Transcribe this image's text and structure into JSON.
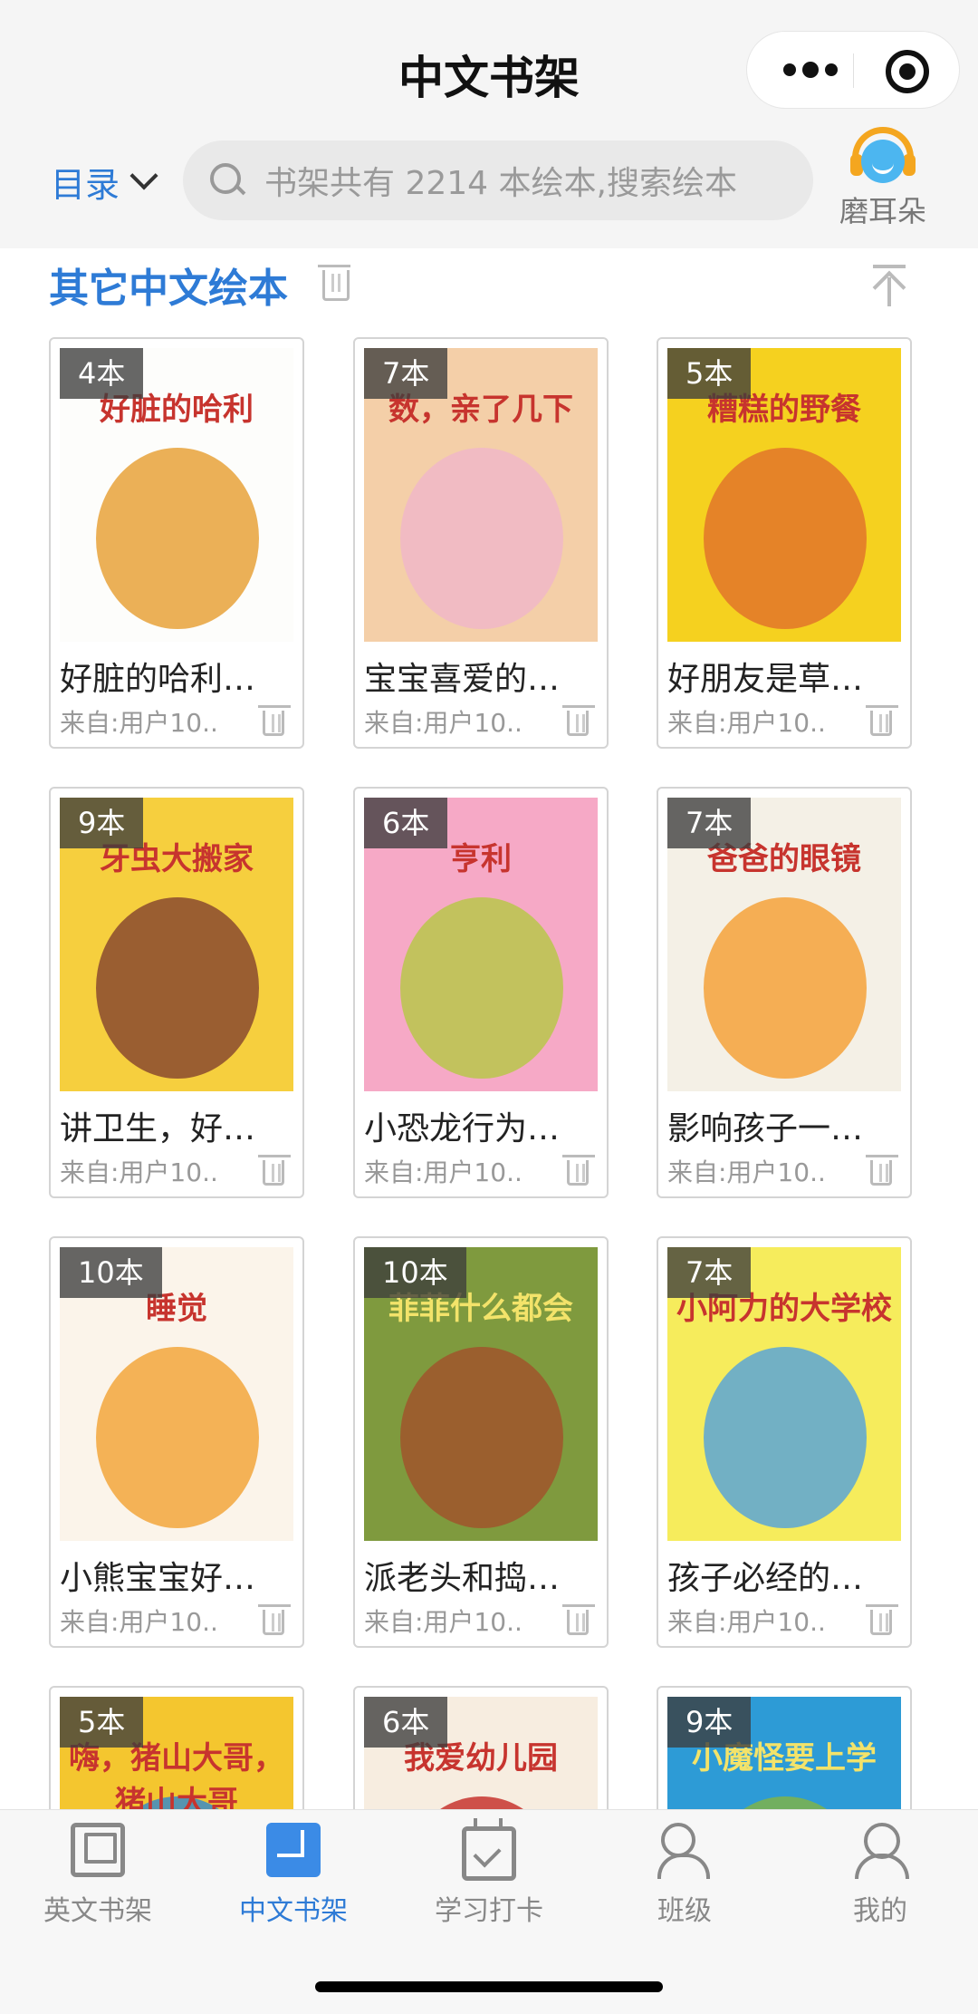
{
  "header": {
    "title": "中文书架",
    "menu_label": "目录",
    "search_placeholder": "书架共有 2214 本绘本,搜索绘本",
    "listen_label": "磨耳朵"
  },
  "section": {
    "title": "其它中文绘本"
  },
  "books": [
    {
      "count": "4本",
      "cover_text": "好脏的哈利",
      "title": "好脏的哈利…",
      "from": "来自:用户10..",
      "colors": [
        "#fdfdfb",
        "#e8a23a"
      ]
    },
    {
      "count": "7本",
      "cover_text": "数，亲了几下",
      "title": "宝宝喜爱的…",
      "from": "来自:用户10..",
      "colors": [
        "#f4cfa8",
        "#f0b7c8"
      ]
    },
    {
      "count": "5本",
      "cover_text": "糟糕的野餐",
      "title": "好朋友是草…",
      "from": "来自:用户10..",
      "colors": [
        "#f5d11f",
        "#e2762a"
      ]
    },
    {
      "count": "9本",
      "cover_text": "牙虫大搬家",
      "title": "讲卫生，好…",
      "from": "来自:用户10..",
      "colors": [
        "#f6cf3e",
        "#8a4a2f"
      ]
    },
    {
      "count": "6本",
      "cover_text": "亨利",
      "title": "小恐龙行为…",
      "from": "来自:用户10..",
      "colors": [
        "#f6a9c6",
        "#b8c74a"
      ]
    },
    {
      "count": "7本",
      "cover_text": "爸爸的眼镜",
      "title": "影响孩子一…",
      "from": "来自:用户10..",
      "colors": [
        "#f4f0e6",
        "#f5a23a"
      ]
    },
    {
      "count": "10本",
      "cover_text": "睡觉",
      "title": "小熊宝宝好…",
      "from": "来自:用户10..",
      "colors": [
        "#fbf4ea",
        "#f2a63c"
      ]
    },
    {
      "count": "10本",
      "cover_text": "菲菲什么都会",
      "title": "派老头和捣…",
      "from": "来自:用户10..",
      "colors": [
        "#7f9a3e",
        "#a0552c"
      ]
    },
    {
      "count": "7本",
      "cover_text": "小阿力的大学校",
      "title": "孩子必经的…",
      "from": "来自:用户10..",
      "colors": [
        "#f6ec5c",
        "#5aa6d6"
      ]
    },
    {
      "count": "5本",
      "cover_text": "嗨，猪山大哥，猪山大哥",
      "title": "",
      "from": "",
      "colors": [
        "#f4c62f",
        "#3a8bc7"
      ]
    },
    {
      "count": "6本",
      "cover_text": "我爱幼儿园",
      "title": "",
      "from": "",
      "colors": [
        "#f7ede0",
        "#c7342e"
      ]
    },
    {
      "count": "9本",
      "cover_text": "小魔怪要上学",
      "title": "",
      "from": "",
      "colors": [
        "#2d9bd6",
        "#7fb34a"
      ]
    }
  ],
  "tabs": [
    {
      "label": "英文书架",
      "icon": "book-icon",
      "active": false
    },
    {
      "label": "中文书架",
      "icon": "book-icon",
      "active": true
    },
    {
      "label": "学习打卡",
      "icon": "calendar-check-icon",
      "active": false
    },
    {
      "label": "班级",
      "icon": "group-icon",
      "active": false
    },
    {
      "label": "我的",
      "icon": "user-icon",
      "active": false
    }
  ],
  "accent_color": "#2e7bd6"
}
